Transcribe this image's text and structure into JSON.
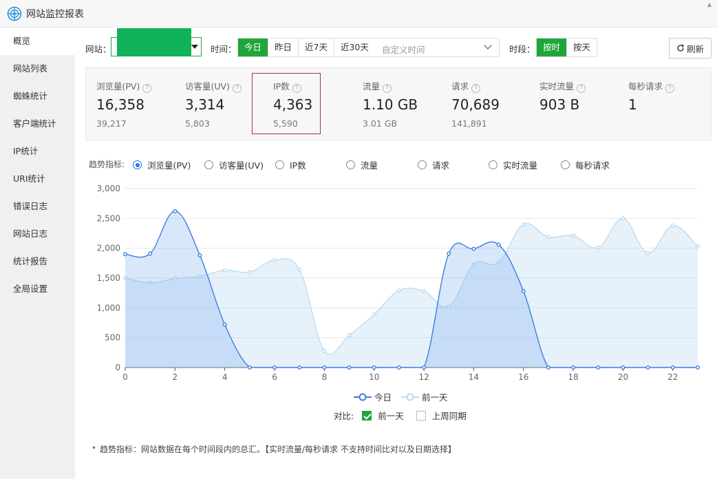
{
  "app": {
    "title": "网站监控报表",
    "logo_icon": "radar-target-icon"
  },
  "sidebar": {
    "items": [
      {
        "label": "概览",
        "active": true
      },
      {
        "label": "网站列表"
      },
      {
        "label": "蜘蛛统计"
      },
      {
        "label": "客户端统计"
      },
      {
        "label": "IP统计"
      },
      {
        "label": "URI统计"
      },
      {
        "label": "错误日志"
      },
      {
        "label": "网站日志"
      },
      {
        "label": "统计报告"
      },
      {
        "label": "全局设置"
      }
    ]
  },
  "filters": {
    "site_label": "网站：",
    "site_value": "",
    "time_label": "时间：",
    "time_options": [
      "今日",
      "昨日",
      "近7天",
      "近30天"
    ],
    "time_selected": "今日",
    "custom_time_placeholder": "自定义时间",
    "period_label": "时段：",
    "period_options": [
      "按时",
      "按天"
    ],
    "period_selected": "按时",
    "refresh_label": "刷新"
  },
  "stats": [
    {
      "label": "浏览量(PV)",
      "value": "16,358",
      "prev": "39,217"
    },
    {
      "label": "访客量(UV)",
      "value": "3,314",
      "prev": "5,803"
    },
    {
      "label": "IP数",
      "value": "4,363",
      "prev": "5,590",
      "highlighted": true
    },
    {
      "label": "流量",
      "value": "1.10 GB",
      "prev": "3.01 GB"
    },
    {
      "label": "请求",
      "value": "70,689",
      "prev": "141,891"
    },
    {
      "label": "实时流量",
      "value": "903 B",
      "prev": ""
    },
    {
      "label": "每秒请求",
      "value": "1",
      "prev": ""
    }
  ],
  "trend": {
    "label": "趋势指标:",
    "options": [
      "浏览量(PV)",
      "访客量(UV)",
      "IP数",
      "流量",
      "请求",
      "实时流量",
      "每秒请求"
    ],
    "selected": "浏览量(PV)"
  },
  "chart_data": {
    "type": "area",
    "x": [
      0,
      1,
      2,
      3,
      4,
      5,
      6,
      7,
      8,
      9,
      10,
      11,
      12,
      13,
      14,
      15,
      16,
      17,
      18,
      19,
      20,
      21,
      22,
      23
    ],
    "xticks": [
      0,
      2,
      4,
      6,
      8,
      10,
      12,
      14,
      16,
      18,
      20,
      22
    ],
    "ylim": [
      0,
      3000
    ],
    "yticks": [
      "0",
      "500",
      "1,000",
      "1,500",
      "2,000",
      "2,500",
      "3,000"
    ],
    "series": [
      {
        "name": "今日",
        "color": "#3a7fe0",
        "values": [
          1900,
          1910,
          2620,
          1880,
          720,
          0,
          0,
          0,
          0,
          0,
          0,
          0,
          0,
          1910,
          1990,
          2060,
          1280,
          0,
          0,
          0,
          0,
          0,
          0,
          0
        ]
      },
      {
        "name": "前一天",
        "color": "#b7d8f2",
        "values": [
          1500,
          1420,
          1490,
          1530,
          1630,
          1600,
          1800,
          1640,
          280,
          540,
          890,
          1290,
          1280,
          1020,
          1730,
          1760,
          2400,
          2190,
          2210,
          2010,
          2500,
          1920,
          2380,
          2030
        ]
      }
    ],
    "grid": true
  },
  "compare": {
    "label": "对比:",
    "options": [
      {
        "label": "前一天",
        "checked": true
      },
      {
        "label": "上周同期",
        "checked": false
      }
    ]
  },
  "note": "趋势指标：网站数据在每个时间段内的总汇。【实时流量/每秒请求 不支持时间比对以及日期选择】"
}
